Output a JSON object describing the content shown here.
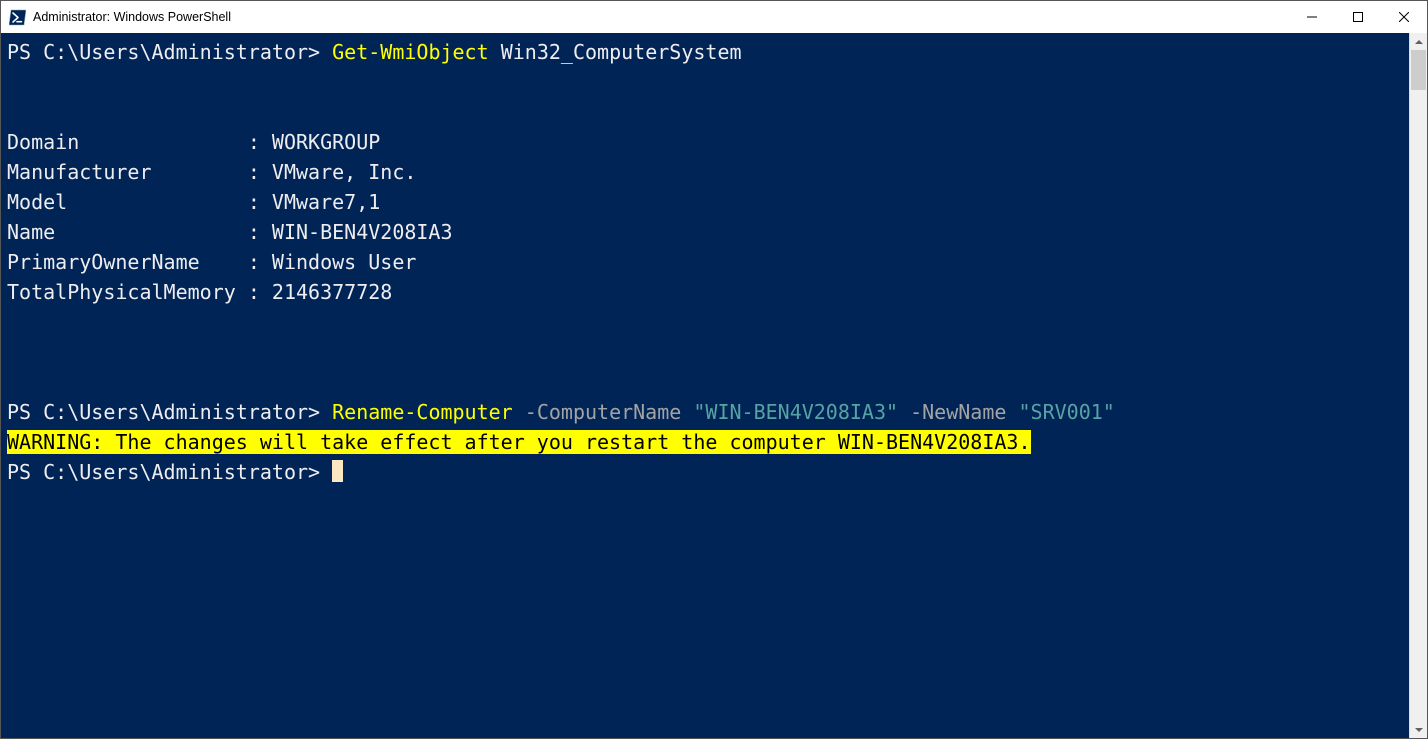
{
  "window": {
    "title": "Administrator: Windows PowerShell"
  },
  "terminal": {
    "prompt": "PS C:\\Users\\Administrator> ",
    "cmd1": "Get-WmiObject",
    "cmd1_arg": "Win32_ComputerSystem",
    "wmi": {
      "line_domain": "Domain              : WORKGROUP",
      "line_mfr": "Manufacturer        : VMware, Inc.",
      "line_model": "Model               : VMware7,1",
      "line_name": "Name                : WIN-BEN4V208IA3",
      "line_owner": "PrimaryOwnerName    : Windows User",
      "line_mem": "TotalPhysicalMemory : 2146377728"
    },
    "cmd2": "Rename-Computer",
    "cmd2_p1": " -ComputerName ",
    "cmd2_v1": "\"WIN-BEN4V208IA3\"",
    "cmd2_p2": " -NewName ",
    "cmd2_v2": "\"SRV001\"",
    "warning": "WARNING: The changes will take effect after you restart the computer WIN-BEN4V208IA3."
  }
}
